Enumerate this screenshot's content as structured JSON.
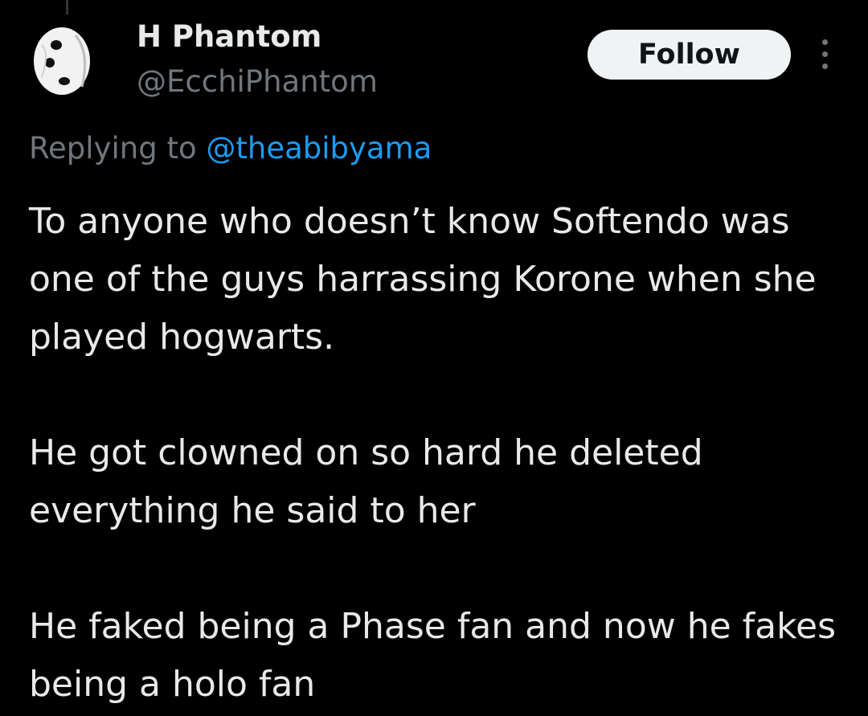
{
  "author": {
    "display_name": "H Phantom",
    "handle": "@EcchiPhantom",
    "avatar_icon": "soccer-ball-mask-avatar"
  },
  "actions": {
    "follow_label": "Follow",
    "more_icon": "more-options-icon"
  },
  "reply_context": {
    "prefix": "Replying to",
    "mention": "@theabibyama"
  },
  "tweet": {
    "paragraphs": [
      "To anyone who doesn’t know Softendo was one of the guys harrassing Korone when she played hogwarts.",
      "He got clowned on so hard he deleted everything he said to her",
      "He faked being a Phase fan and now he fakes being a holo fan"
    ]
  },
  "colors": {
    "background": "#000000",
    "primary_text": "#e7e9ea",
    "secondary_text": "#71767b",
    "link": "#1d9bf0",
    "follow_button_bg": "#eff3f4"
  }
}
